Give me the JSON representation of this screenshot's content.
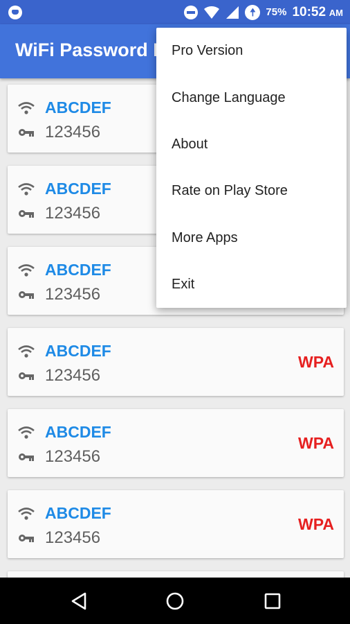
{
  "status_bar": {
    "battery": "75%",
    "time": "10:52",
    "ampm": "AM"
  },
  "app_bar": {
    "title": "WiFi Password F"
  },
  "networks": [
    {
      "ssid": "ABCDEF",
      "password": "123456",
      "security": ""
    },
    {
      "ssid": "ABCDEF",
      "password": "123456",
      "security": ""
    },
    {
      "ssid": "ABCDEF",
      "password": "123456",
      "security": ""
    },
    {
      "ssid": "ABCDEF",
      "password": "123456",
      "security": "WPA"
    },
    {
      "ssid": "ABCDEF",
      "password": "123456",
      "security": "WPA"
    },
    {
      "ssid": "ABCDEF",
      "password": "123456",
      "security": "WPA"
    }
  ],
  "menu": {
    "items": [
      "Pro Version",
      "Change Language",
      "About",
      "Rate on Play Store",
      "More Apps",
      "Exit"
    ]
  },
  "nav_bar": {
    "buttons": [
      "back-icon",
      "home-icon",
      "recents-icon"
    ]
  },
  "colors": {
    "status_bar": "#3a64cc",
    "app_bar": "#4173db",
    "ssid": "#1e8ae6",
    "security": "#e62020",
    "password": "#5f5f5f"
  }
}
